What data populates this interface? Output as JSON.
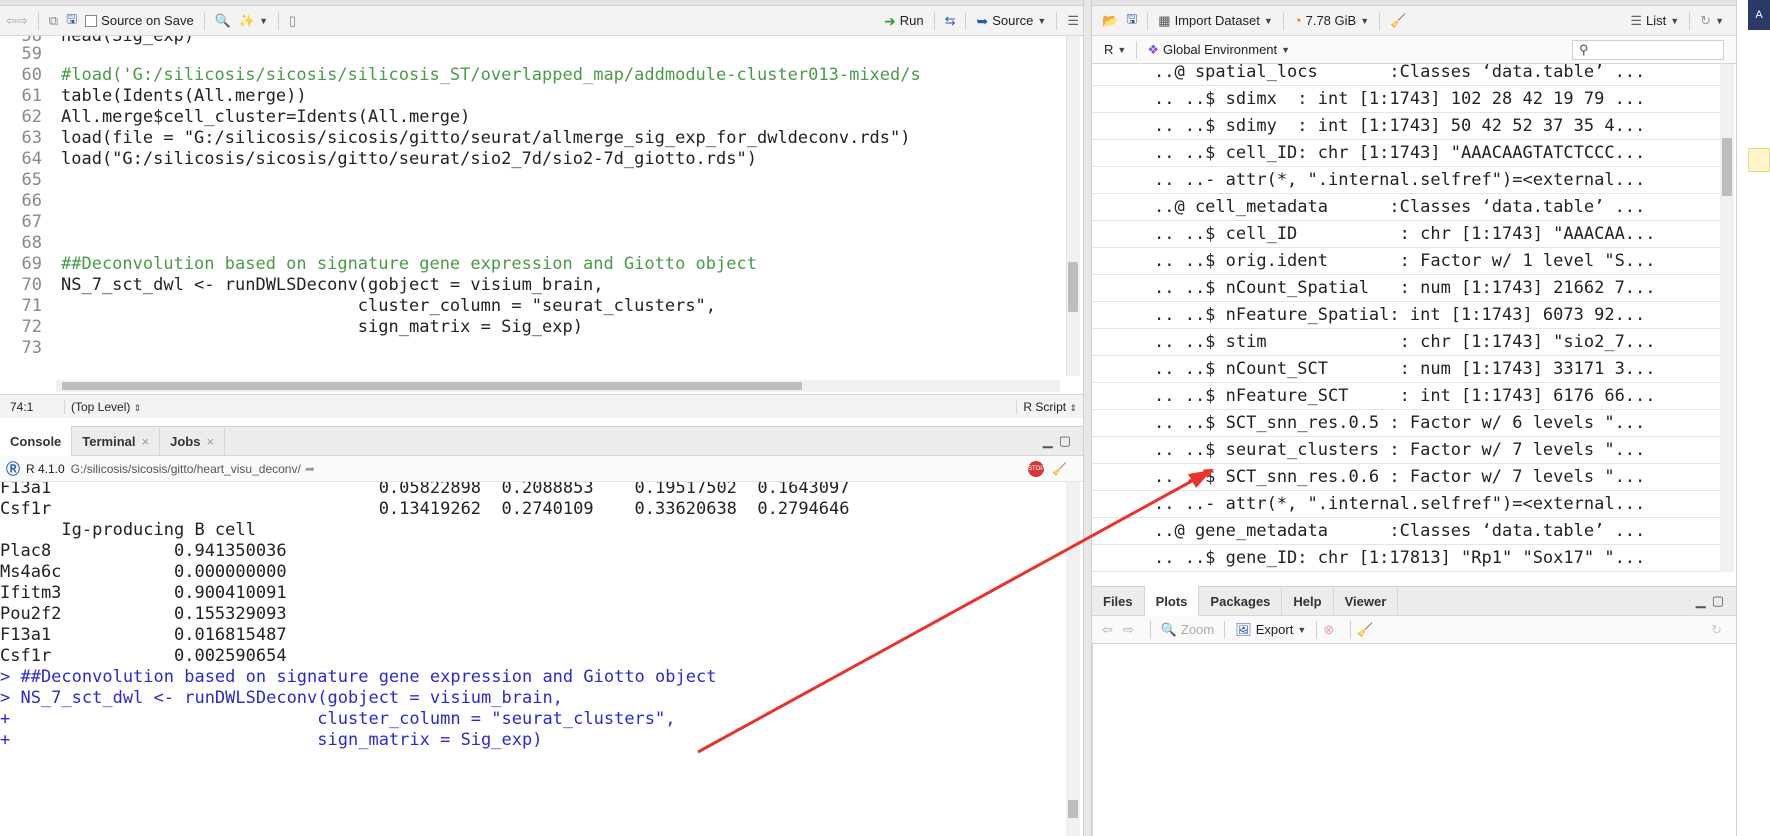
{
  "editor": {
    "toolbar": {
      "source_on_save": "Source on Save",
      "run": "Run",
      "source": "Source"
    },
    "lines": [
      {
        "num": "58",
        "text": "head(Sig_exp)"
      },
      {
        "num": "59",
        "text": ""
      },
      {
        "num": "60",
        "text": "#load('G:/silicosis/sicosis/silicosis_ST/overlapped_map/addmodule-cluster013-mixed/s"
      },
      {
        "num": "61",
        "text": "table(Idents(All.merge))"
      },
      {
        "num": "62",
        "text": "All.merge$cell_cluster=Idents(All.merge)"
      },
      {
        "num": "63",
        "text": "load(file = \"G:/silicosis/sicosis/gitto/seurat/allmerge_sig_exp_for_dwldeconv.rds\")"
      },
      {
        "num": "64",
        "text": "load(\"G:/silicosis/sicosis/gitto/seurat/sio2_7d/sio2-7d_giotto.rds\")"
      },
      {
        "num": "65",
        "text": ""
      },
      {
        "num": "66",
        "text": ""
      },
      {
        "num": "67",
        "text": ""
      },
      {
        "num": "68",
        "text": ""
      },
      {
        "num": "69",
        "text": "##Deconvolution based on signature gene expression and Giotto object"
      },
      {
        "num": "70",
        "text": "NS_7_sct_dwl <- runDWLSDeconv(gobject = visium_brain,"
      },
      {
        "num": "71",
        "text": "                             cluster_column = \"seurat_clusters\","
      },
      {
        "num": "72",
        "text": "                             sign_matrix = Sig_exp)"
      },
      {
        "num": "73",
        "text": ""
      }
    ],
    "status": {
      "position": "74:1",
      "scope": "(Top Level)",
      "file_type": "R Script"
    }
  },
  "console": {
    "tabs": [
      "Console",
      "Terminal",
      "Jobs"
    ],
    "r_version": "R 4.1.0",
    "path": "G:/silicosis/sicosis/gitto/heart_visu_deconv/",
    "lines": [
      {
        "type": "out",
        "text": "F13a1                                0.05822898  0.2088853    0.19517502  0.1643097"
      },
      {
        "type": "out",
        "text": "Csf1r                                0.13419262  0.2740109    0.33620638  0.2794646"
      },
      {
        "type": "out",
        "text": "      Ig-producing B cell"
      },
      {
        "type": "out",
        "text": "Plac8            0.941350036"
      },
      {
        "type": "out",
        "text": "Ms4a6c           0.000000000"
      },
      {
        "type": "out",
        "text": "Ifitm3           0.900410091"
      },
      {
        "type": "out",
        "text": "Pou2f2           0.155329093"
      },
      {
        "type": "out",
        "text": "F13a1            0.016815487"
      },
      {
        "type": "out",
        "text": "Csf1r            0.002590654"
      },
      {
        "type": "in",
        "text": "> ##Deconvolution based on signature gene expression and Giotto object"
      },
      {
        "type": "in",
        "text": "> NS_7_sct_dwl <- runDWLSDeconv(gobject = visium_brain,"
      },
      {
        "type": "in",
        "text": "+                              cluster_column = \"seurat_clusters\","
      },
      {
        "type": "in",
        "text": "+                              sign_matrix = Sig_exp)"
      }
    ]
  },
  "environment": {
    "toolbar": {
      "import_dataset": "Import Dataset",
      "memory": "7.78 GiB",
      "view_mode": "List"
    },
    "language": "R",
    "scope": "Global Environment",
    "rows": [
      "..@ spatial_locs       :Classes ‘data.table’ ...",
      ".. ..$ sdimx  : int [1:1743] 102 28 42 19 79 ...",
      ".. ..$ sdimy  : int [1:1743] 50 42 52 37 35 4...",
      ".. ..$ cell_ID: chr [1:1743] \"AAACAAGTATCTCCC...",
      ".. ..- attr(*, \".internal.selfref\")=<external...",
      "..@ cell_metadata      :Classes ‘data.table’ ...",
      ".. ..$ cell_ID          : chr [1:1743] \"AAACAA...",
      ".. ..$ orig.ident       : Factor w/ 1 level \"S...",
      ".. ..$ nCount_Spatial   : num [1:1743] 21662 7...",
      ".. ..$ nFeature_Spatial: int [1:1743] 6073 92...",
      ".. ..$ stim             : chr [1:1743] \"sio2_7...",
      ".. ..$ nCount_SCT       : num [1:1743] 33171 3...",
      ".. ..$ nFeature_SCT     : int [1:1743] 6176 66...",
      ".. ..$ SCT_snn_res.0.5 : Factor w/ 6 levels \"...",
      ".. ..$ seurat_clusters : Factor w/ 7 levels \"...",
      ".. ..$ SCT_snn_res.0.6 : Factor w/ 7 levels \"...",
      ".. ..- attr(*, \".internal.selfref\")=<external...",
      "..@ gene_metadata      :Classes ‘data.table’ ...",
      ".. ..$ gene_ID: chr [1:17813] \"Rp1\" \"Sox17\" \"..."
    ]
  },
  "files_pane": {
    "tabs": [
      "Files",
      "Plots",
      "Packages",
      "Help",
      "Viewer"
    ],
    "active_tab": "Plots",
    "toolbar": {
      "zoom": "Zoom",
      "export": "Export"
    }
  },
  "colors": {
    "arrow": "#e8322b",
    "console_input": "#2a2ad0",
    "comment": "#4a9a4a"
  }
}
